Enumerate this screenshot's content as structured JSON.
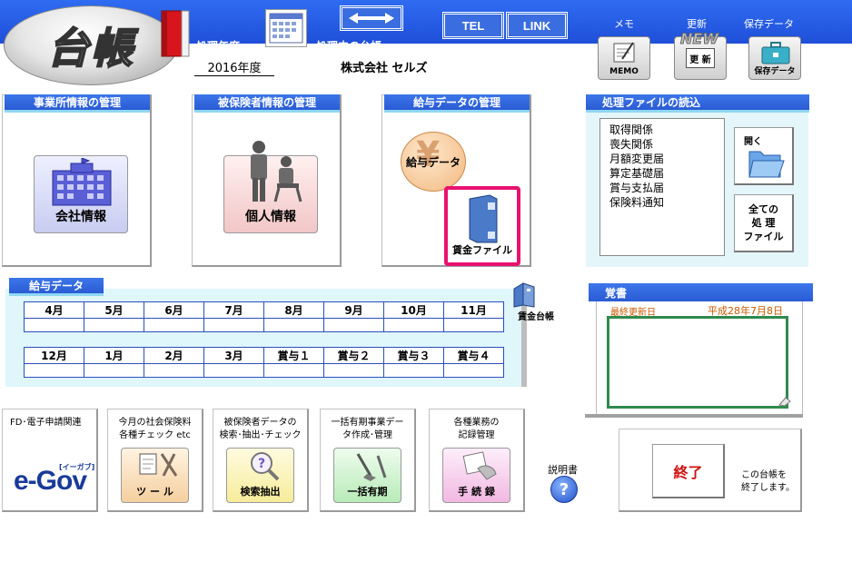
{
  "header": {
    "logo_text": "台帳",
    "fiscal_label": "処理年度",
    "fiscal_value": "2016年度",
    "ledger_label": "処理中の台帳",
    "ledger_value": "株式会社 セルズ",
    "tel_label": "TEL",
    "link_label": "LINK",
    "memo_label": "メモ",
    "memo_icon_text": "MEMO",
    "update_label": "更新",
    "update_icon_new": "NEW",
    "update_icon_text": "更 新",
    "save_label": "保存データ",
    "save_icon_text": "保存データ"
  },
  "company_panel": {
    "title": "事業所情報の管理",
    "button_label": "会社情報"
  },
  "insured_panel": {
    "title": "被保険者情報の管理",
    "button_label": "個人情報"
  },
  "salary_panel": {
    "title": "給与データの管理",
    "salary_button_label": "給与データ",
    "wage_file_label": "賃金ファイル"
  },
  "file_panel": {
    "title": "処理ファイルの読込",
    "items": [
      "取得関係",
      "喪失関係",
      "月額変更届",
      "算定基礎届",
      "賞与支払届",
      "保険料通知"
    ],
    "open_label": "開く",
    "all_files_label_1": "全ての",
    "all_files_label_2": "処 理",
    "all_files_label_3": "ファイル"
  },
  "salary_data": {
    "title": "給与データ",
    "row1": [
      "4月",
      "5月",
      "6月",
      "7月",
      "8月",
      "9月",
      "10月",
      "11月"
    ],
    "row2": [
      "12月",
      "1月",
      "2月",
      "3月",
      "賞与１",
      "賞与２",
      "賞与３",
      "賞与４"
    ],
    "ledger_icon_label": "賃金台帳"
  },
  "notes": {
    "title": "覚書",
    "last_update_label": "最終更新日",
    "last_update_value": "平成28年7月8日"
  },
  "tiles": {
    "egov_text": "FD･電子申請関連",
    "egov_logo": "e-Gov",
    "egov_sub": "[イーガブ]",
    "tool_text": "今月の社会保険料\n各種チェック etc",
    "tool_icon": "ツ ー ル",
    "search_text": "被保険者データの\n検索･抽出･チェック",
    "search_icon": "検索抽出",
    "bulk_text": "一括有期事業デー\nタ作成･管理",
    "bulk_icon": "一括有期",
    "records_text": "各種業務の\n記録管理",
    "records_icon": "手 続 録"
  },
  "manual_label": "説明書",
  "exit": {
    "button_label": "終了",
    "desc": "この台帳を\n終了します。"
  },
  "colors": {
    "header_blue": "#2a5bd4",
    "title_blue": "#3c76ea",
    "accent_magenta": "#e8126e",
    "notes_green": "#2f8a4e",
    "exit_red": "#d01010"
  }
}
